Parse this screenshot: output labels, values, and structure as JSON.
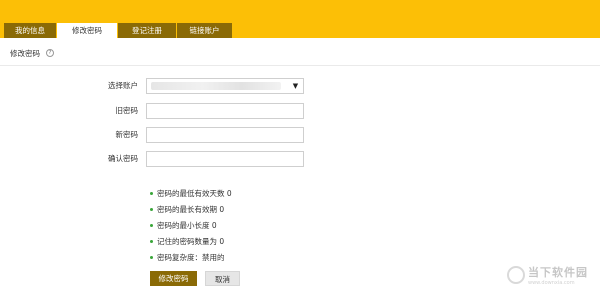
{
  "tabs": [
    {
      "label": "我的信息",
      "active": false
    },
    {
      "label": "修改密码",
      "active": true
    },
    {
      "label": "登记注册",
      "active": false
    },
    {
      "label": "链接账户",
      "active": false
    }
  ],
  "section": {
    "title": "修改密码",
    "help_icon": "help-circle-icon"
  },
  "form": {
    "account_label": "选择账户",
    "account_value": "",
    "old_label": "旧密码",
    "old_value": "",
    "new_label": "新密码",
    "new_value": "",
    "confirm_label": "确认密码",
    "confirm_value": ""
  },
  "rules": [
    "密码的最低有效天数 0",
    "密码的最长有效期 0",
    "密码的最小长度 0",
    "记住的密码数量为 0",
    "密码复杂度：禁用的"
  ],
  "buttons": {
    "submit": "修改密码",
    "cancel": "取消"
  },
  "watermark": {
    "main": "当下软件园",
    "sub": "www.downxia.com"
  },
  "colors": {
    "topbar": "#fcbf06",
    "tab_dark": "#8a6a06",
    "primary_button": "#8a6a06",
    "bullet": "#3aa53a"
  }
}
